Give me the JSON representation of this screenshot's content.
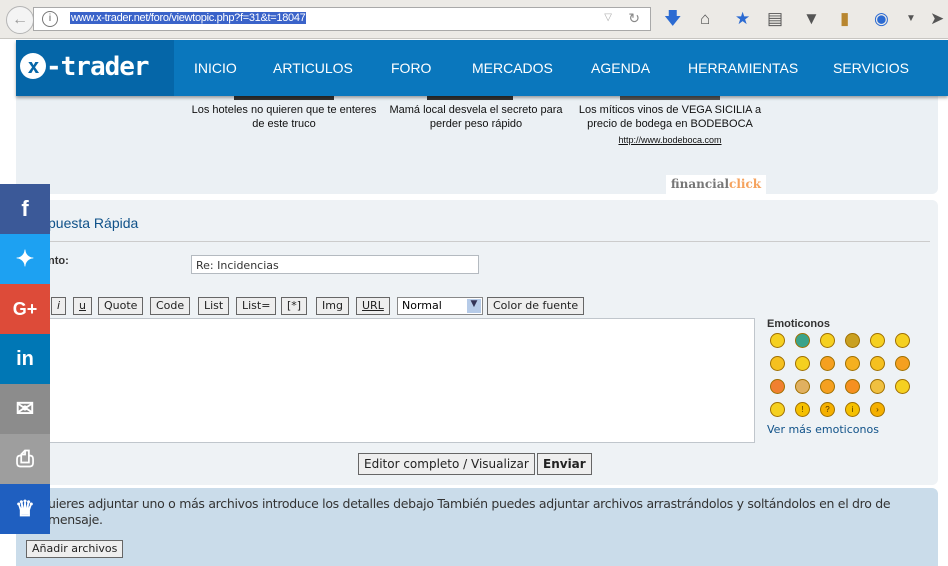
{
  "browser": {
    "url": "www.x-trader.net/foro/viewtopic.php?f=31&t=18047"
  },
  "nav": {
    "logo": "x-trader",
    "items": [
      "INICIO",
      "ARTICULOS",
      "FORO",
      "MERCADOS",
      "AGENDA",
      "HERRAMIENTAS",
      "SERVICIOS"
    ]
  },
  "ads": [
    {
      "text": "Los hoteles no quieren que te enteres de este truco"
    },
    {
      "text": "Mamá local desvela el secreto para perder peso rápido"
    },
    {
      "text": "Los míticos vinos de VEGA SICILIA a precio de bodega en BODEBOCA",
      "link": "http://www.bodeboca.com"
    }
  ],
  "adbrand": {
    "a": "financial",
    "b": "click"
  },
  "reply": {
    "title": "puesta Rápida",
    "subject_label": "nto:",
    "subject_value": "Re: Incidencias",
    "format_buttons": [
      "i",
      "u",
      "Quote",
      "Code",
      "List",
      "List=",
      "[*]",
      "Img",
      "URL"
    ],
    "font_size": "Normal",
    "color_button": "Color de fuente",
    "emoticons_title": "Emoticonos",
    "more_emoticons": "Ver más emoticonos",
    "full_editor": "Editor completo / Visualizar",
    "send": "Enviar"
  },
  "attach": {
    "info": "uieres adjuntar uno o más archivos introduce los detalles debajo También puedes adjuntar archivos arrastrándolos y soltándolos en el dro de mensaje.",
    "button": "Añadir archivos"
  },
  "social": [
    "facebook",
    "twitter",
    "google-plus",
    "linkedin",
    "email",
    "print",
    "crown"
  ]
}
